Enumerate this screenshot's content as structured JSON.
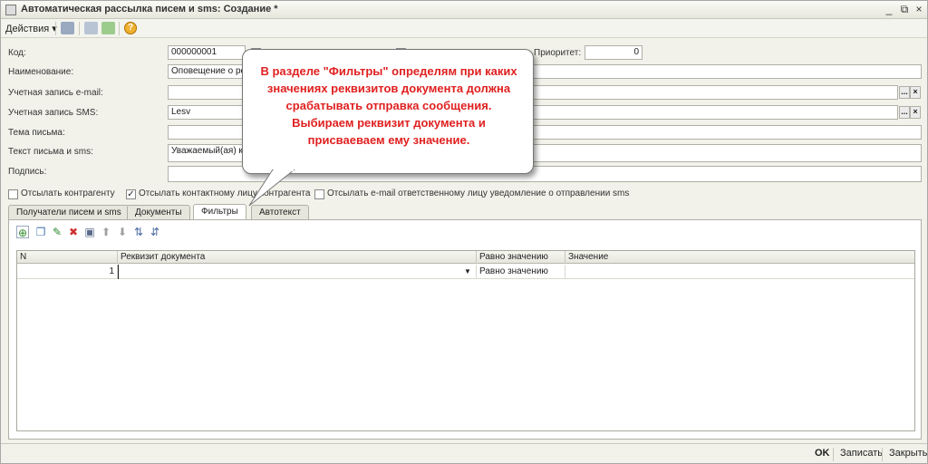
{
  "window": {
    "title": "Автоматическая рассылка писем и sms: Создание *",
    "controls": [
      "_",
      "⧉",
      "×"
    ]
  },
  "toolbar": {
    "actions_label": "Действия ▾",
    "help_label": "?"
  },
  "form": {
    "code_label": "Код:",
    "code_value": "000000001",
    "priority_label": "Приоритет:",
    "priority_value": "0",
    "name_label": "Наименование:",
    "name_value": "Оповещение о рег",
    "email_account_label": "Учетная запись e-mail:",
    "email_account_value": "",
    "sms_account_label": "Учетная запись SMS:",
    "sms_account_value": "Lesv",
    "subject_label": "Тема письма:",
    "subject_value": "",
    "text_label": "Текст письма и sms:",
    "text_value": "Уважаемый(ая) кл",
    "signature_label": "Подпись:",
    "signature_value": "",
    "select_button": "...",
    "clear_button": "×"
  },
  "checkboxes": {
    "send_counterparty": "Отсылать контрагенту",
    "send_contact_person": "Отсылать контактному лицу контрагента",
    "send_email_responsible": "Отсылать e-mail ответственному лицу уведомление о отправлении sms"
  },
  "tabs": [
    {
      "label": "Получатели писем и sms"
    },
    {
      "label": "Документы"
    },
    {
      "label": "Фильтры"
    },
    {
      "label": "Автотекст"
    }
  ],
  "grid": {
    "headers": [
      "N",
      "Реквизит документа",
      "Равно значению",
      "Значение"
    ],
    "rows": [
      {
        "n": "1",
        "attribute": "",
        "equals": "Равно значению",
        "value": ""
      }
    ]
  },
  "callout": {
    "text": "В разделе \"Фильтры\" определям при каких значениях реквизитов документа должна срабатывать отправка сообщения. Выбираем реквизит документа и присваеваем ему значение."
  },
  "status_bar": {
    "ok": "OK",
    "save": "Записать",
    "close": "Закрыть"
  }
}
